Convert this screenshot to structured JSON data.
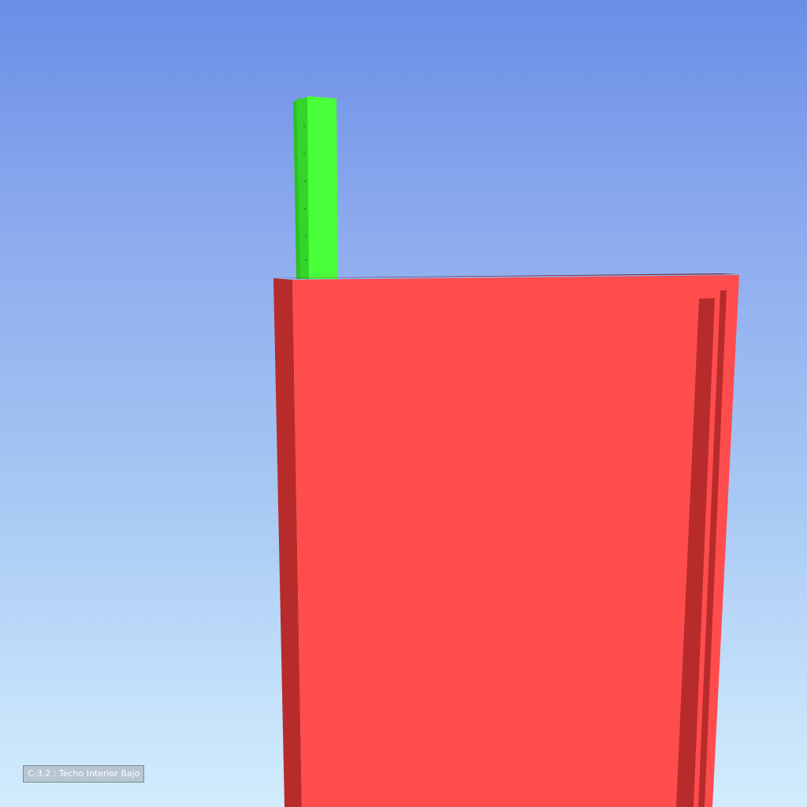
{
  "viewport": {
    "background_top": "#6a8ee6",
    "background_bottom": "#d2ecfc"
  },
  "objects": {
    "green_element": {
      "color": "#48ff3a",
      "shade": "#2cbf24"
    },
    "red_element": {
      "color": "#ff4d4d",
      "shade": "#b82b2b"
    }
  },
  "selection_label": {
    "text": "C-3.2 : Techo Interior Bajo"
  }
}
